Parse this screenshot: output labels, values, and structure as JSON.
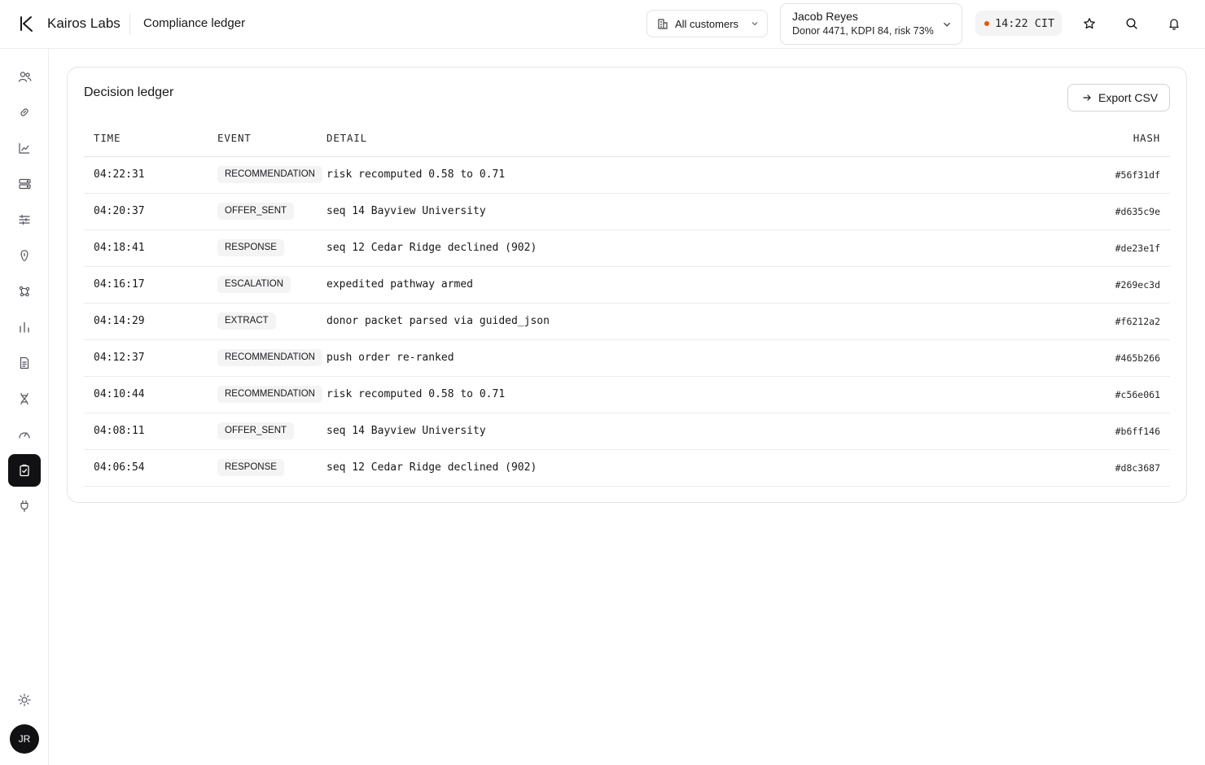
{
  "header": {
    "brand": "Kairos Labs",
    "page_title": "Compliance ledger",
    "customer_filter": "All customers",
    "patient": {
      "name": "Jacob Reyes",
      "summary": "Donor 4471, KDPI 84, risk 73%"
    },
    "clock": "14:22 CIT",
    "status_dot_color": "#ea580c"
  },
  "sidebar": {
    "items": [
      {
        "icon": "users-icon"
      },
      {
        "icon": "link-icon"
      },
      {
        "icon": "trend-chart-icon"
      },
      {
        "icon": "server-icon"
      },
      {
        "icon": "sliders-icon"
      },
      {
        "icon": "kidney-icon"
      },
      {
        "icon": "network-icon"
      },
      {
        "icon": "bar-chart-icon"
      },
      {
        "icon": "document-icon"
      },
      {
        "icon": "dna-icon"
      },
      {
        "icon": "gauge-icon"
      },
      {
        "icon": "clipboard-check-icon",
        "active": true
      },
      {
        "icon": "plug-icon"
      }
    ],
    "settings_icon": "sun-icon",
    "avatar_initials": "JR"
  },
  "ledger": {
    "title": "Decision ledger",
    "export_label": "Export CSV",
    "columns": {
      "time": "TIME",
      "event": "EVENT",
      "detail": "DETAIL",
      "hash": "HASH"
    },
    "rows": [
      {
        "time": "04:22:31",
        "event": "RECOMMENDATION",
        "detail": "risk recomputed 0.58 to 0.71",
        "hash": "#56f31df"
      },
      {
        "time": "04:20:37",
        "event": "OFFER_SENT",
        "detail": "seq 14 Bayview University",
        "hash": "#d635c9e"
      },
      {
        "time": "04:18:41",
        "event": "RESPONSE",
        "detail": "seq 12 Cedar Ridge declined (902)",
        "hash": "#de23e1f"
      },
      {
        "time": "04:16:17",
        "event": "ESCALATION",
        "detail": "expedited pathway armed",
        "hash": "#269ec3d"
      },
      {
        "time": "04:14:29",
        "event": "EXTRACT",
        "detail": "donor packet parsed via guided_json",
        "hash": "#f6212a2"
      },
      {
        "time": "04:12:37",
        "event": "RECOMMENDATION",
        "detail": "push order re-ranked",
        "hash": "#465b266"
      },
      {
        "time": "04:10:44",
        "event": "RECOMMENDATION",
        "detail": "risk recomputed 0.58 to 0.71",
        "hash": "#c56e061"
      },
      {
        "time": "04:08:11",
        "event": "OFFER_SENT",
        "detail": "seq 14 Bayview University",
        "hash": "#b6ff146"
      },
      {
        "time": "04:06:54",
        "event": "RESPONSE",
        "detail": "seq 12 Cedar Ridge declined (902)",
        "hash": "#d8c3687"
      }
    ]
  }
}
